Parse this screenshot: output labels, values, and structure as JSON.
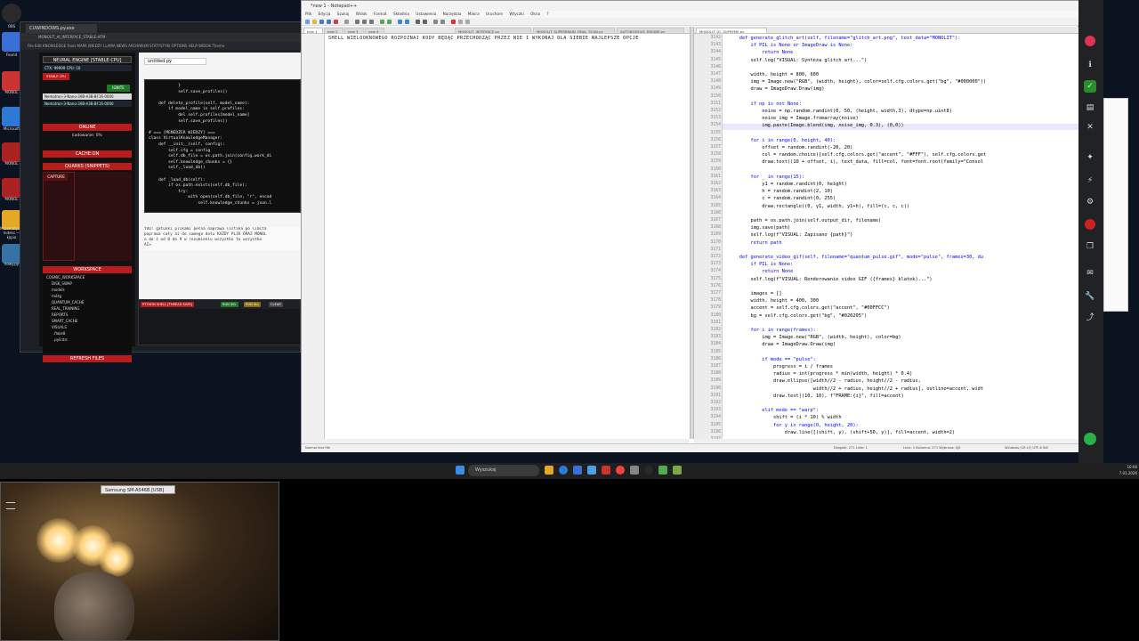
{
  "desktop": {
    "icons": [
      {
        "label": "OBS",
        "color": "#2a2a2a"
      },
      {
        "label": "Found",
        "color": "#3a6fd8"
      },
      {
        "label": "",
        "color": "#c33"
      },
      {
        "label": "MONOL",
        "color": "#c33"
      },
      {
        "label": "Microsoft",
        "color": "#2b7bd6"
      },
      {
        "label": "MONOL",
        "color": "#a22"
      },
      {
        "label": "MONOL",
        "color": "#a22"
      },
      {
        "label": "",
        "color": "#e5a823"
      },
      {
        "label": "Matematyczny Indeks — kopia",
        "color": "#e5a823"
      },
      {
        "label": "nowy.py",
        "color": "#3572a5"
      }
    ]
  },
  "ide": {
    "tab_title": "CUWINDOWS.py.exe",
    "address": "MONOLIT_AI_INTERFACE_STABLE.HTM",
    "menu": "File  Edit  KNOWLEDGE  Tools  MAPA WIEDZY  LLAMA  NEWS  ARCHIWUM  STATYSTYKI  OPTIONS  HELP  WIDOK  Theme",
    "engine_label": "NEURAL ENGINE [STABLE-CPU]",
    "ctx": "CTX: 99999  CPU: 16",
    "stable_label": "STABLE CPU",
    "ignite": "IGNITE",
    "model1": "Nemotron-3-Nano-30B-A3B-BF16-0000",
    "model2": "Nemotron-3-Nano-30B-A3B-BF16-0000",
    "online": "ONLINE",
    "loading": "Ładowanie: 0%",
    "cache": "CACHE:ON",
    "quarks": "QUARKS (SNIPPETS)",
    "capture": "CAPTURE",
    "delete": "DELETE",
    "workspace": "WORKSPACE",
    "tree": [
      "COSMIC_WORKSPACE",
      "DISK_SWAP",
      "models",
      "mózg",
      "QUANTUM_CACHE",
      "REAL_TRAINING",
      "REPORTS",
      "SMART_CACHE",
      "VISUALS",
      ".flake8",
      ".pylintrc",
      "__init__.py"
    ],
    "refresh": "REFRESH FILES",
    "file_tab": "untitled.py",
    "code": "            }\n            self.save_profiles()\n\n    def delete_profile(self, model_name):\n        if model_name in self.profiles:\n            del self.profiles[model_name]\n            self.save_profiles()\n\n# === [MENEDŻER WIEDZY] ===\nclass VirtualKnowledgeManager:\n    def __init__(self, config):\n        self.cfg = config\n        self.db_file = os.path.join(config.work_di\n        self.knowledge_chunks = {}\n        self._load_db()\n\n    def _load_db(self):\n        if os.path.exists(self.db_file):\n            try:\n                with open(self.db_file, \"r\", encod\n                    self.knowledge_chunks = json.l",
    "info": "YOU: gatunki plikami pełna naprawa listika po limita\npoprawa cały ai do samego dołu KAŻDY PLIK ORAZ MONOL\na do ś od 0 do 9 w rozumieniu wszystko to wszystko\nAI>",
    "shell_title": "PYTHON SHELL [THREAD SAFE]",
    "shell_btns": [
      "RUN SEL",
      "RUN ALL",
      "CLEAR"
    ]
  },
  "npp": {
    "title": "*new 1 - Notepad++",
    "menu": [
      "Plik",
      "Edycja",
      "Szukaj",
      "Widok",
      "Format",
      "Składnia",
      "Ustawienia",
      "Narzędzia",
      "Makra",
      "Uruchom",
      "Wtyczki",
      "Okna",
      "?"
    ],
    "pane1_tabs": [
      "new 1",
      "new 2",
      "new 3",
      "new 4",
      "MONOLIT_INTERFACE.py",
      "MONOLIT_SUPERBRAIN_FINAL_SCAN.py",
      "AUTONOMOUS_ENGINE.py"
    ],
    "pane2_tabs": [
      "MONOLIT_UL_SUPREME.py"
    ],
    "pane1_line": "SHELL WIELOOKNOWEGO ROZPOZNAJ KODY BĘDĄC PRZECHODZĄC PRZEZ NIE I WYKONAJ DLA SIEBIE NAJLEPSZE OPCJE",
    "gutter": [
      "3142",
      "3143",
      "3144",
      "3145",
      "3146",
      "3147",
      "3148",
      "3149",
      "3150",
      "3151",
      "3152",
      "3153",
      "3154",
      "3155",
      "3156",
      "3157",
      "3158",
      "3159",
      "3160",
      "3161",
      "3162",
      "3163",
      "3164",
      "3165",
      "3166",
      "3167",
      "3168",
      "3169",
      "3170",
      "3171",
      "3172",
      "3173",
      "3174",
      "3175",
      "3176",
      "3177",
      "3178",
      "3179",
      "3180",
      "3181",
      "3182",
      "3183",
      "3184",
      "3185",
      "3186",
      "3187",
      "3188",
      "3189",
      "3190",
      "3191",
      "3192",
      "3193",
      "3194",
      "3195",
      "3196",
      "3197"
    ],
    "code": [
      "    def generate_glitch_art(self, filename=\"glitch_art.png\", text_data=\"MONOLIT\"):",
      "        if PIL is None or ImageDraw is None:",
      "            return None",
      "        self.log(\"VISUAL: Synteza glitch art...\")",
      "",
      "        width, height = 800, 600",
      "        img = Image.new(\"RGB\", (width, height), color=self.cfg.colors.get(\"bg\", \"#000000\"))",
      "        draw = ImageDraw.Draw(img)",
      "",
      "        if np is not None:",
      "            noise = np.random.randint(0, 50, (height, width,3), dtype=np.uint8)",
      "            noise_img = Image.fromarray(noise)",
      "            img.paste(Image.blend(img, noise_img, 0.3), (0,0))",
      "",
      "        for i in range(0, height, 40):",
      "            offset = random.randint(-20, 20)",
      "            col = random.choice([self.cfg.colors.get(\"accent\", \"#FFF\"), self.cfg.colors.get",
      "            draw.text((10 + offset, i), text_data, fill=col, font=font.root(family=\"Consol",
      "",
      "        for _ in range(15):",
      "            y1 = random.randint(0, height)",
      "            h = random.randint(2, 10)",
      "            c = random.randint(0, 255)",
      "            draw.rectangle((0, y1, width, y1+h), fill=(c, c, c))",
      "",
      "        path = os.path.join(self.output_dir, filename)",
      "        img.save(path)",
      "        self.log(f\"VISUAL: Zapisano {path}\")",
      "        return path",
      "",
      "    def generate_video_gif(self, filename=\"quantum_pulse.gif\", mode=\"pulse\", frames=30, du",
      "        if PIL is None:",
      "            return None",
      "        self.log(f\"VISUAL: Renderowanie video GIF ({frames} klatek)...\")",
      "",
      "        images = []",
      "        width, height = 400, 300",
      "        accent = self.cfg.colors.get(\"accent\", \"#00FFCC\")",
      "        bg = self.cfg.colors.get(\"bg\", \"#020205\")",
      "",
      "        for i in range(frames):",
      "            img = Image.new(\"RGB\", (width, height), color=bg)",
      "            draw = ImageDraw.Draw(img)",
      "",
      "            if mode == \"pulse\":",
      "                progress = i / frames",
      "                radius = int(progress * min(width, height) * 0.4)",
      "                draw.ellipse([width//2 - radius, height//2 - radius,",
      "                              width//2 + radius, height//2 + radius], outline=accent, widt",
      "                draw.text((10, 10), f\"FRAME:{i}\", fill=accent)",
      "",
      "            elif mode == \"warp\":",
      "                shift = (i * 10) % width",
      "                for y in range(0, height, 20):",
      "                    draw.line([(shift, y), (shift+50, y)], fill=accent, width=2)",
      ""
    ],
    "status_left": "Normal text file",
    "status_mid": "Długość: 271   Linie: 1",
    "status_pos": "Linia: 1   Kolumna: 271   Wybrano: 0|0",
    "status_right": "Windows (CR LF)   UTF-8   INS"
  },
  "taskbar": {
    "search_placeholder": "Wyszukaj",
    "time": "16:06",
    "date": "7.01.2026"
  },
  "webcam": {
    "label": "Samsung SM-A546B [USB]"
  },
  "colors": {
    "accent_red": "#c41a1a",
    "accent_green": "#1a8f2a",
    "keyword_blue": "#0000ff"
  }
}
